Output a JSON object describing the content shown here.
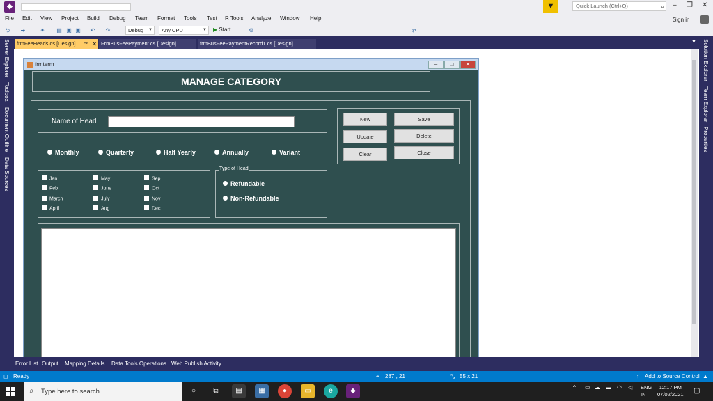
{
  "titlebar": {
    "quick_launch_placeholder": "Quick Launch (Ctrl+Q)"
  },
  "menu": {
    "items": [
      "File",
      "Edit",
      "View",
      "Project",
      "Build",
      "Debug",
      "Team",
      "Format",
      "Tools",
      "Test",
      "R Tools",
      "Analyze",
      "Window",
      "Help"
    ],
    "signin": "Sign in"
  },
  "toolbar": {
    "config": "Debug",
    "platform": "Any CPU",
    "start": "Start"
  },
  "side_tabs_left": [
    "Server Explorer",
    "Toolbox",
    "Document Outline",
    "Data Sources"
  ],
  "side_tabs_right": [
    "Solution Explorer",
    "Team Explorer",
    "Properties"
  ],
  "doc_tabs": [
    {
      "label": "frmFeeHeads.cs [Design]",
      "active": true
    },
    {
      "label": "FrmBusFeePayment.cs [Design]",
      "active": false
    },
    {
      "label": "frmBusFeePaymentRecord1.cs [Design]",
      "active": false
    }
  ],
  "form": {
    "title": "frmterm",
    "heading": "MANAGE CATEGORY",
    "name_label": "Name of Head",
    "name_value": "",
    "frequency_options": [
      "Monthly",
      "Quarterly",
      "Half Yearly",
      "Annually",
      "Variant"
    ],
    "buttons": {
      "new": "New",
      "save": "Save",
      "update": "Update",
      "delete": "Delete",
      "clear": "Clear",
      "close": "Close"
    },
    "months": [
      "Jan",
      "Feb",
      "March",
      "April",
      "May",
      "June",
      "July",
      "Aug",
      "Sep",
      "Oct",
      "Nov",
      "Dec"
    ],
    "type_of_head": {
      "legend": "Type of Head",
      "options": [
        "Refundable",
        "Non-Refundable"
      ]
    }
  },
  "output_tabs": [
    "Error List",
    "Output",
    "Mapping Details",
    "Data Tools Operations",
    "Web Publish Activity"
  ],
  "status": {
    "ready": "Ready",
    "position": "287 , 21",
    "size": "55 x 21",
    "source_control": "Add to Source Control"
  },
  "taskbar": {
    "search_placeholder": "Type here to search",
    "lang_line1": "ENG",
    "lang_line2": "IN",
    "time": "12:17 PM",
    "date": "07/02/2021"
  },
  "colors": {
    "vs_accent": "#68217a",
    "status_bar": "#007acc",
    "form_bg": "#2f4f4f",
    "active_tab": "#ffcc66",
    "tool_window_strip": "#2d2d60"
  }
}
